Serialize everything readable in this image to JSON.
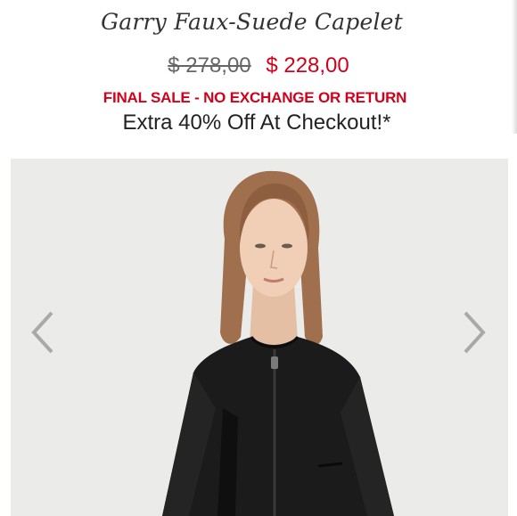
{
  "product": {
    "name": "Garry Faux-Suede Capelet",
    "original_price": "$ 278,00",
    "sale_price": "$ 228,00",
    "final_sale_notice": "FINAL SALE - NO EXCHANGE OR RETURN",
    "promo": "Extra 40% Off At Checkout!*"
  },
  "gallery": {
    "prev_icon": "chevron-left-icon",
    "next_icon": "chevron-right-icon",
    "background_color": "#ebebe9"
  },
  "colors": {
    "sale": "#d0021b",
    "text": "#222222",
    "muted": "#666666"
  }
}
